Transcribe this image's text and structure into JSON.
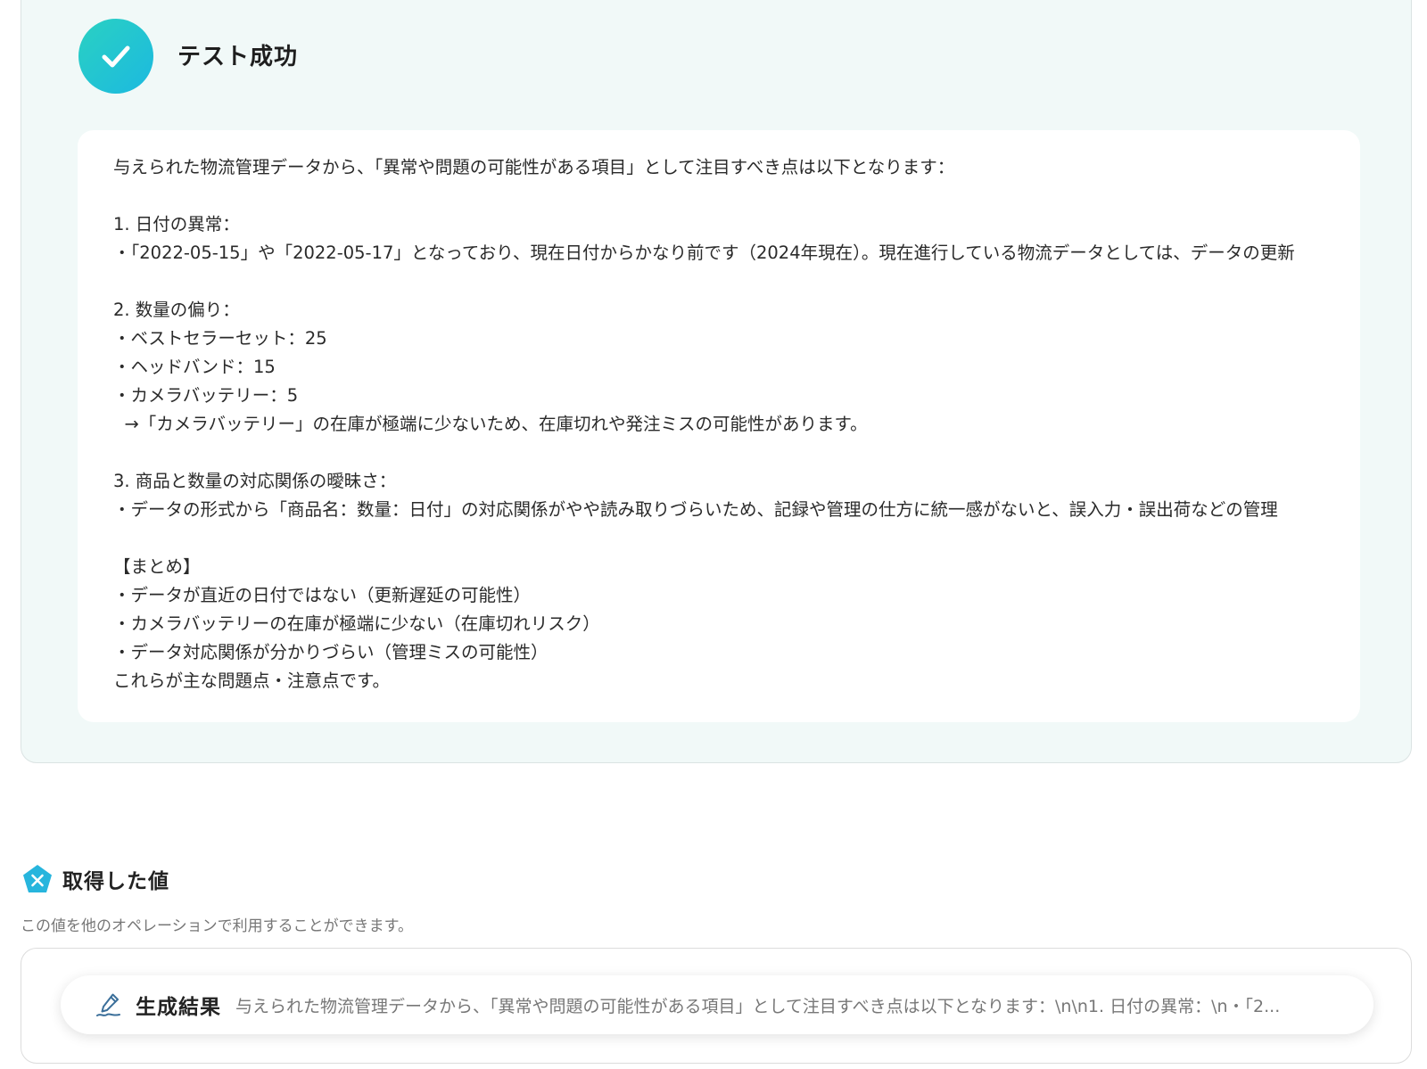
{
  "success": {
    "title": "テスト成功",
    "badge_icon": "check-icon",
    "accent_from": "#2ad1c2",
    "accent_to": "#1cb9e0"
  },
  "result_lines": [
    "与えられた物流管理データから、「異常や問題の可能性がある項目」として注目すべき点は以下となります：",
    "",
    "1. 日付の異常：",
    "・「2022-05-15」や「2022-05-17」となっており、現在日付からかなり前です（2024年現在）。現在進行している物流データとしては、データの更新",
    "",
    "2. 数量の偏り：",
    "・ベストセラーセット：25",
    "・ヘッドバンド：15",
    "・カメラバッテリー：5",
    "  →「カメラバッテリー」の在庫が極端に少ないため、在庫切れや発注ミスの可能性があります。",
    "",
    "3. 商品と数量の対応関係の曖昧さ：",
    "・データの形式から「商品名：数量：日付」の対応関係がやや読み取りづらいため、記録や管理の仕方に統一感がないと、誤入力・誤出荷などの管理",
    "",
    "【まとめ】",
    "・データが直近の日付ではない（更新遅延の可能性）",
    "・カメラバッテリーの在庫が極端に少ない（在庫切れリスク）",
    "・データ対応関係が分かりづらい（管理ミスの可能性）",
    "これらが主な問題点・注意点です。"
  ],
  "values_section": {
    "icon": "variable-x-icon",
    "title": "取得した値",
    "description": "この値を他のオペレーションで利用することができます。",
    "item": {
      "icon": "pen-icon",
      "label": "生成結果",
      "value": "与えられた物流管理データから、「異常や問題の可能性がある項目」として注目すべき点は以下となります：\\n\\n1. 日付の異常：\\n・「2..."
    }
  }
}
